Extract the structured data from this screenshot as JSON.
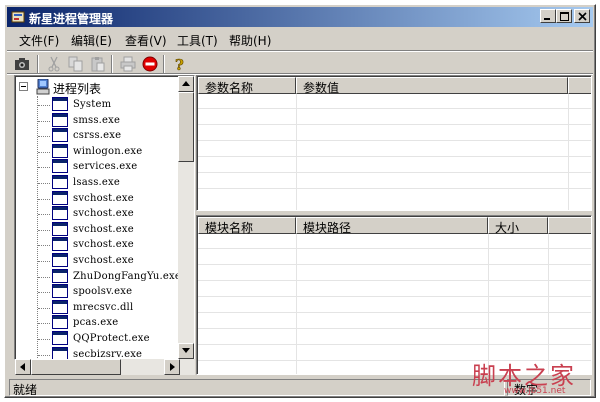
{
  "window": {
    "title": "新星进程管理器"
  },
  "menu": {
    "items": [
      {
        "label": "文件(F)"
      },
      {
        "label": "编辑(E)"
      },
      {
        "label": "查看(V)"
      },
      {
        "label": "工具(T)"
      },
      {
        "label": "帮助(H)"
      }
    ]
  },
  "toolbar": {
    "icons": [
      "camera-icon",
      "cut-icon",
      "copy-icon",
      "paste-icon",
      "print-icon",
      "stop-icon",
      "help-icon"
    ],
    "stop_color": "#e00000",
    "help_color": "#c8a000"
  },
  "tree": {
    "root_label": "进程列表",
    "items": [
      "System",
      "smss.exe",
      "csrss.exe",
      "winlogon.exe",
      "services.exe",
      "lsass.exe",
      "svchost.exe",
      "svchost.exe",
      "svchost.exe",
      "svchost.exe",
      "svchost.exe",
      "ZhuDongFangYu.exe",
      "spoolsv.exe",
      "mrecsvc.dll",
      "pcas.exe",
      "QQProtect.exe",
      "secbizsrv.exe"
    ]
  },
  "params_table": {
    "columns": [
      "参数名称",
      "参数值"
    ]
  },
  "modules_table": {
    "columns": [
      "模块名称",
      "模块路径",
      "大小"
    ]
  },
  "status": {
    "text": "就绪",
    "right_panel": "数字"
  },
  "watermark": {
    "main": "脚本之家",
    "sub": "www.jb51.net"
  },
  "colors": {
    "titlebar_start": "#0a246a",
    "titlebar_end": "#a6caf0",
    "face": "#d4d0c8",
    "watermark": "#c94050"
  }
}
